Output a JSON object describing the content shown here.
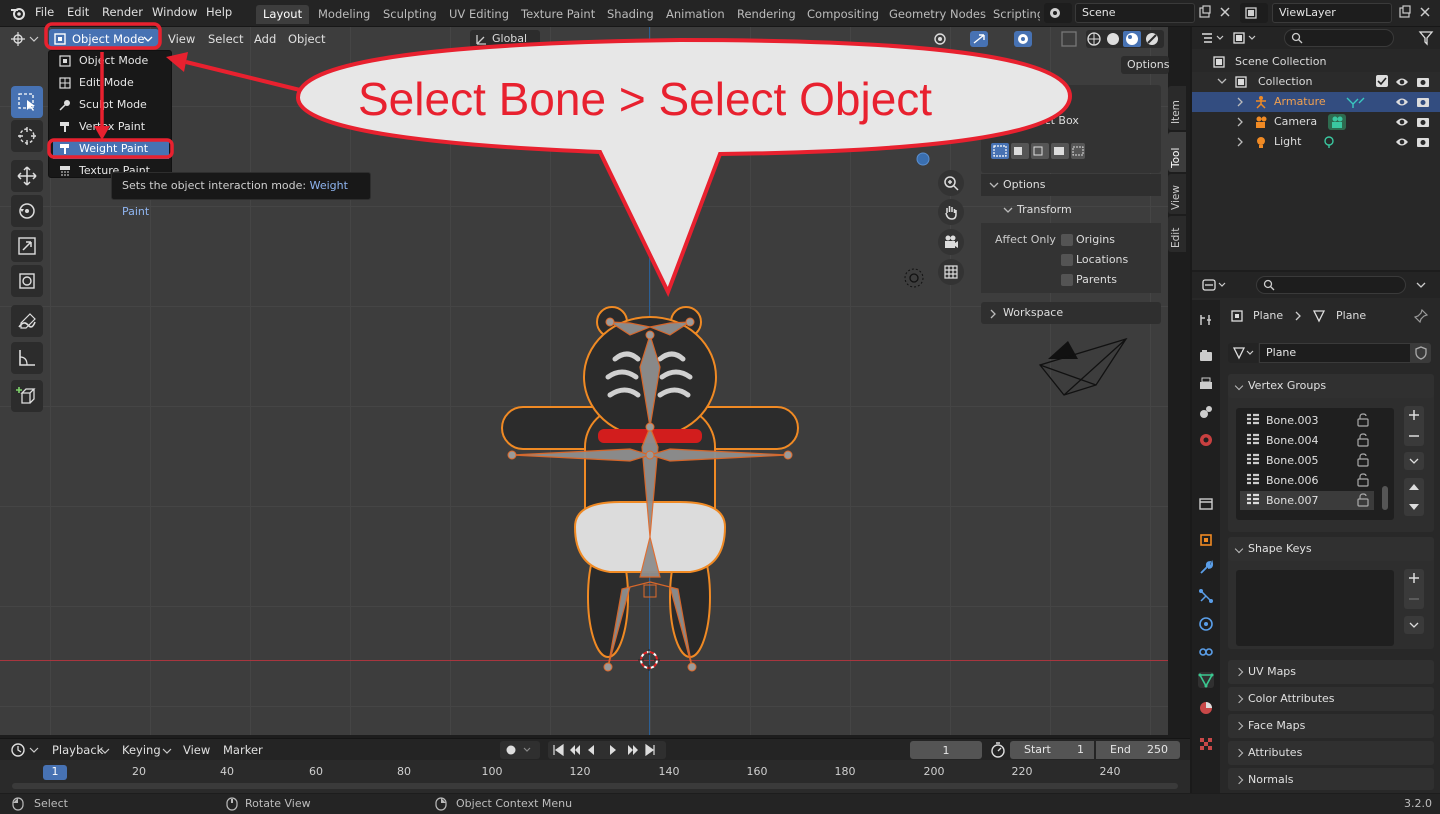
{
  "topbar": {
    "menus": [
      "File",
      "Edit",
      "Render",
      "Window",
      "Help"
    ],
    "workspaces": [
      "Layout",
      "Modeling",
      "Sculpting",
      "UV Editing",
      "Texture Paint",
      "Shading",
      "Animation",
      "Rendering",
      "Compositing",
      "Geometry Nodes",
      "Scripting"
    ],
    "active_workspace": "Layout",
    "scene_name": "Scene",
    "view_layer": "ViewLayer"
  },
  "viewport_header": {
    "mode_label": "Object Mode",
    "menus": [
      "View",
      "Select",
      "Add",
      "Object"
    ],
    "global_label": "Global",
    "options_label": "Options"
  },
  "mode_dropdown": {
    "items": [
      "Object Mode",
      "Edit Mode",
      "Sculpt Mode",
      "Vertex Paint",
      "Weight Paint",
      "Texture Paint"
    ],
    "selected": "Weight Paint"
  },
  "tooltip": {
    "prefix": "Sets the object interaction mode:",
    "value": "Weight Paint"
  },
  "annotation": {
    "text": "Select Bone  > Select Object",
    "color": "#e8212f"
  },
  "npanel": {
    "tabs": [
      "Item",
      "Tool",
      "View",
      "Edit"
    ],
    "select_box": "Select Box",
    "options": "Options",
    "transform": "Transform",
    "affect_only": "Affect Only",
    "checks": [
      "Origins",
      "Locations",
      "Parents"
    ],
    "workspace": "Workspace"
  },
  "outliner": {
    "root": "Scene Collection",
    "collection": "Collection",
    "objects": [
      {
        "name": "Armature",
        "selected": true
      },
      {
        "name": "Camera",
        "selected": false
      },
      {
        "name": "Light",
        "selected": false
      }
    ]
  },
  "properties": {
    "breadcrumb": [
      "Plane",
      "Plane"
    ],
    "data_name": "Plane",
    "vertex_groups_title": "Vertex Groups",
    "vertex_groups": [
      "Bone.003",
      "Bone.004",
      "Bone.005",
      "Bone.006",
      "Bone.007"
    ],
    "selected_group": "Bone.007",
    "panels": [
      "Shape Keys",
      "UV Maps",
      "Color Attributes",
      "Face Maps",
      "Attributes",
      "Normals"
    ]
  },
  "timeline": {
    "menus": [
      "Playback",
      "Keying",
      "View",
      "Marker"
    ],
    "current_frame": "1",
    "start_label": "Start",
    "start": "1",
    "end_label": "End",
    "end": "250",
    "ruler": [
      "1",
      "20",
      "40",
      "60",
      "80",
      "100",
      "120",
      "140",
      "160",
      "180",
      "200",
      "220",
      "240"
    ]
  },
  "statusbar": {
    "left": "Select",
    "middle": "Rotate View",
    "right": "Object Context Menu",
    "version": "3.2.0"
  }
}
